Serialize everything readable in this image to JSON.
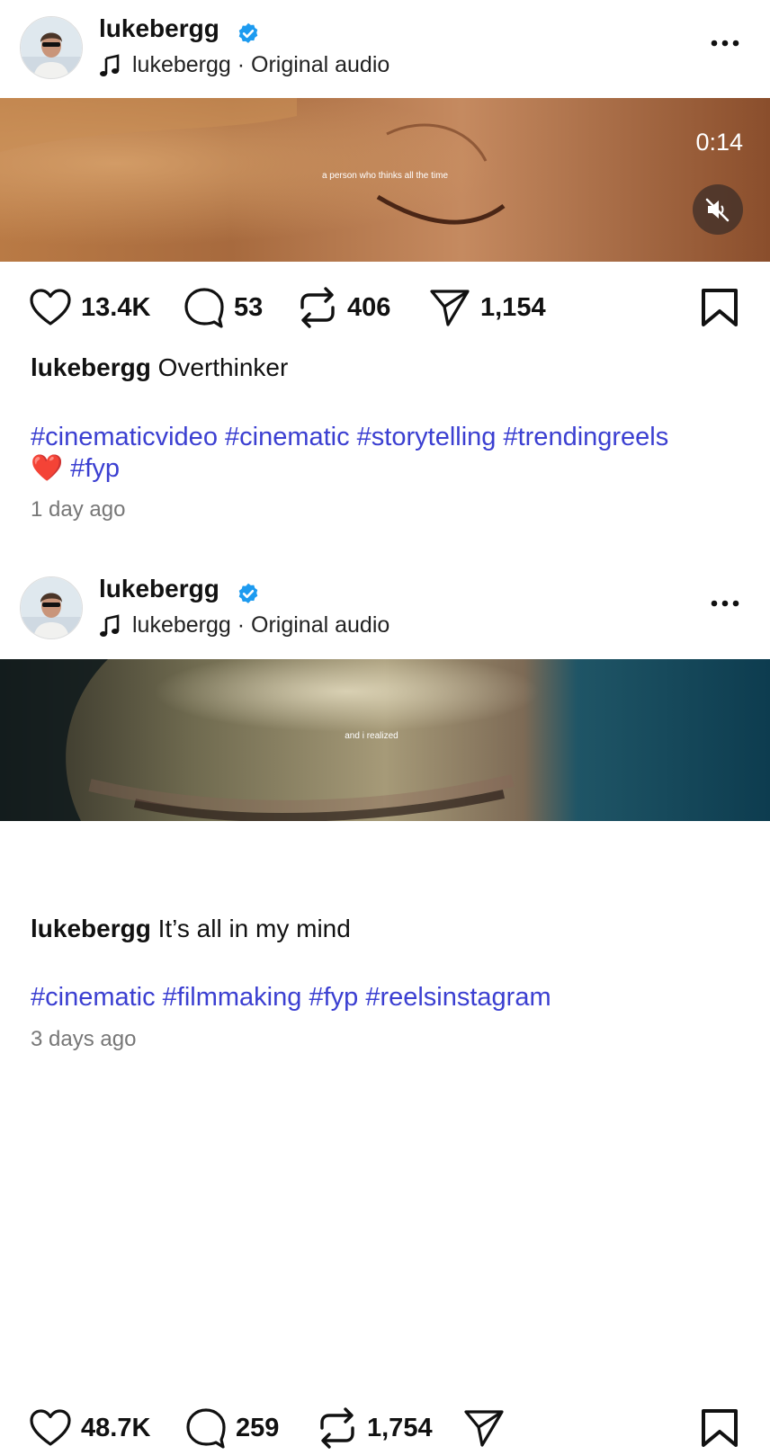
{
  "posts": [
    {
      "username": "lukebergg",
      "audio": "lukebergg · Original audio",
      "overlay_text": "a person who thinks all the time",
      "duration": "0:14",
      "likes": "13.4K",
      "comments": "53",
      "reposts": "406",
      "shares": "1,154",
      "caption_user": "lukebergg",
      "caption_text": "Overthinker",
      "hashtags_line1": "#cinematicvideo #cinematic #storytelling #trendingreels",
      "hashtags_line2_emoji": "❤️",
      "hashtags_line2": "#fyp",
      "time": "1 day ago"
    },
    {
      "username": "lukebergg",
      "audio": "lukebergg · Original audio",
      "overlay_text": "and i realized",
      "likes": "48.7K",
      "comments": "259",
      "reposts": "1,754",
      "caption_user": "lukebergg",
      "caption_text": "It’s all in my mind",
      "hashtags_line1": "#cinematic #filmmaking #fyp #reelsinstagram",
      "time": "3 days ago"
    }
  ],
  "colors": {
    "verified": "#1d9bf0",
    "hashtag": "#3b3fd1",
    "timestamp": "#777777"
  },
  "icons": [
    "heart-icon",
    "comment-icon",
    "repost-icon",
    "share-icon",
    "bookmark-icon",
    "more-icon",
    "music-note-icon",
    "mute-icon",
    "verified-badge-icon"
  ]
}
